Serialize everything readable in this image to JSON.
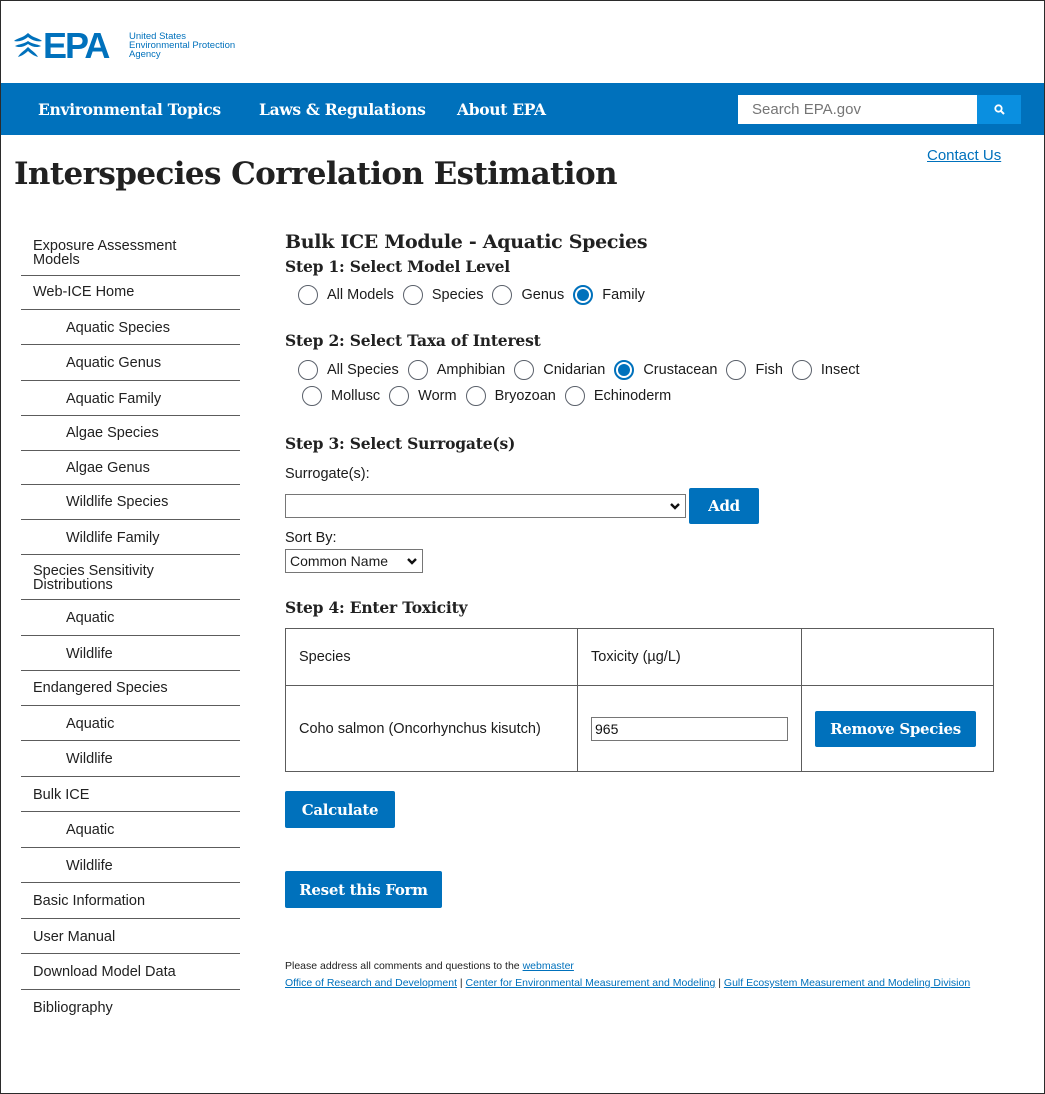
{
  "brand": {
    "logo_text": "EPA",
    "agency_lines": [
      "United States",
      "Environmental Protection",
      "Agency"
    ],
    "primary_color": "#0071bc"
  },
  "nav": {
    "items": [
      "Environmental Topics",
      "Laws & Regulations",
      "About EPA"
    ],
    "search_placeholder": "Search EPA.gov",
    "search_icon": "search-icon"
  },
  "page": {
    "title": "Interspecies Correlation Estimation",
    "contact_label": "Contact Us"
  },
  "sidebar": {
    "items": [
      {
        "label": "Exposure Assessment Models",
        "sub": false
      },
      {
        "label": "Web-ICE Home",
        "sub": false
      },
      {
        "label": "Aquatic Species",
        "sub": true
      },
      {
        "label": "Aquatic Genus",
        "sub": true
      },
      {
        "label": "Aquatic Family",
        "sub": true
      },
      {
        "label": "Algae Species",
        "sub": true
      },
      {
        "label": "Algae Genus",
        "sub": true
      },
      {
        "label": "Wildlife Species",
        "sub": true
      },
      {
        "label": "Wildlife Family",
        "sub": true
      },
      {
        "label": "Species Sensitivity Distributions",
        "sub": false
      },
      {
        "label": "Aquatic",
        "sub": true
      },
      {
        "label": "Wildlife",
        "sub": true
      },
      {
        "label": "Endangered Species",
        "sub": false
      },
      {
        "label": "Aquatic",
        "sub": true
      },
      {
        "label": "Wildlife",
        "sub": true
      },
      {
        "label": "Bulk ICE",
        "sub": false
      },
      {
        "label": "Aquatic",
        "sub": true
      },
      {
        "label": "Wildlife",
        "sub": true
      },
      {
        "label": "Basic Information",
        "sub": false
      },
      {
        "label": "User Manual",
        "sub": false
      },
      {
        "label": "Download Model Data",
        "sub": false
      },
      {
        "label": "Bibliography",
        "sub": false
      }
    ]
  },
  "main": {
    "module_title": "Bulk ICE Module - Aquatic Species",
    "step1": {
      "title": "Step 1: Select Model Level",
      "options": [
        "All Models",
        "Species",
        "Genus",
        "Family"
      ],
      "selected": "Family"
    },
    "step2": {
      "title": "Step 2: Select Taxa of Interest",
      "row1": [
        "All Species",
        "Amphibian",
        "Cnidarian",
        "Crustacean",
        "Fish",
        "Insect"
      ],
      "row2": [
        "Mollusc",
        "Worm",
        "Bryozoan",
        "Echinoderm"
      ],
      "selected": "Crustacean"
    },
    "step3": {
      "title": "Step 3: Select Surrogate(s)",
      "surrogate_label": "Surrogate(s):",
      "surrogate_value": "",
      "add_label": "Add",
      "sort_label": "Sort By:",
      "sort_value": "Common Name"
    },
    "step4": {
      "title": "Step 4: Enter Toxicity",
      "headers": [
        "Species",
        "Toxicity (µg/L)",
        ""
      ],
      "rows": [
        {
          "species": "Coho salmon (Oncorhynchus kisutch)",
          "toxicity": "965",
          "action": "Remove Species"
        }
      ]
    },
    "calculate_label": "Calculate",
    "reset_label": "Reset this Form",
    "footer": {
      "prefix": "Please address all comments and questions to the ",
      "webmaster": "webmaster",
      "link1": "Office of Research and Development",
      "link2": "Center for Environmental Measurement and Modeling",
      "link3": "Gulf Ecosystem Measurement and Modeling Division",
      "sep": " | "
    }
  }
}
